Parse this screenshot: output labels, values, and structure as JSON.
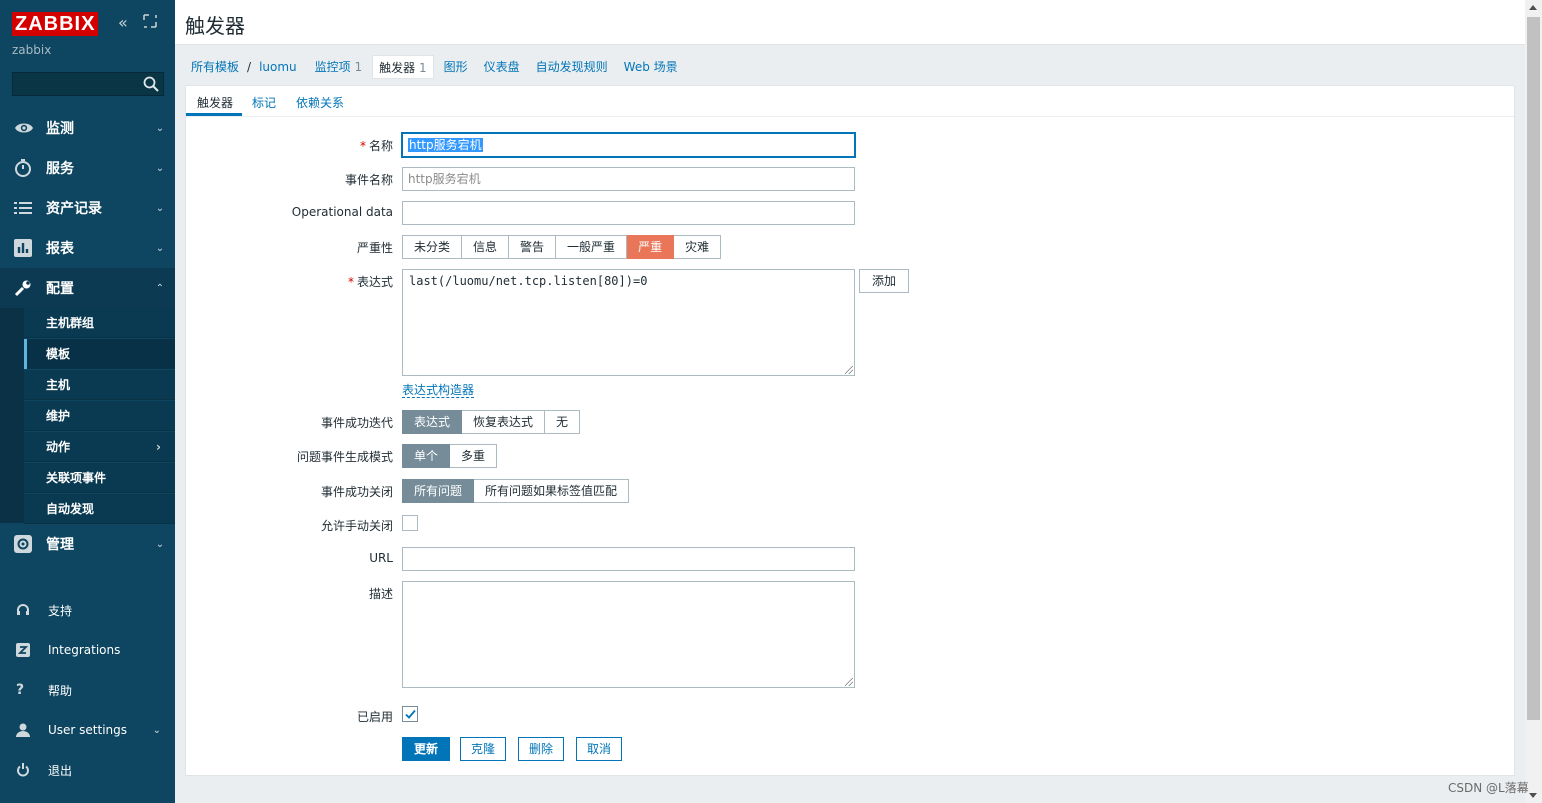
{
  "sidebar": {
    "logo": "ZABBIX",
    "server_name": "zabbix",
    "search_placeholder": "",
    "menu": [
      {
        "label": "监测",
        "icon": "eye-icon"
      },
      {
        "label": "服务",
        "icon": "stopwatch-icon"
      },
      {
        "label": "资产记录",
        "icon": "list-icon"
      },
      {
        "label": "报表",
        "icon": "bar-chart-icon"
      },
      {
        "label": "配置",
        "icon": "wrench-icon"
      }
    ],
    "config_submenu": [
      "主机群组",
      "模板",
      "主机",
      "维护",
      "动作",
      "关联项事件",
      "自动发现"
    ],
    "admin_label": "管理",
    "bottom": [
      {
        "label": "支持",
        "icon": "headset-icon"
      },
      {
        "label": "Integrations",
        "icon": "zabbix-z-icon"
      },
      {
        "label": "帮助",
        "icon": "question-icon"
      },
      {
        "label": "User settings",
        "icon": "user-icon"
      },
      {
        "label": "退出",
        "icon": "power-icon"
      }
    ]
  },
  "header": {
    "title": "触发器"
  },
  "breadcrumb": {
    "all_templates": "所有模板",
    "separator": "/",
    "template": "luomu",
    "items": "监控项",
    "items_count": "1",
    "triggers": "触发器",
    "triggers_count": "1",
    "graphs": "图形",
    "dashboards": "仪表盘",
    "discovery": "自动发现规则",
    "web": "Web 场景"
  },
  "tabs": [
    "触发器",
    "标记",
    "依赖关系"
  ],
  "form": {
    "name_label": "名称",
    "name_value": "http服务宕机",
    "event_name_label": "事件名称",
    "event_name_placeholder": "http服务宕机",
    "opdata_label": "Operational data",
    "opdata_value": "",
    "severity_label": "严重性",
    "severity_options": [
      "未分类",
      "信息",
      "警告",
      "一般严重",
      "严重",
      "灾难"
    ],
    "severity_selected": "严重",
    "expression_label": "表达式",
    "expression_value": "last(/luomu/net.tcp.listen[80])=0",
    "add_button": "添加",
    "expr_builder_link": "表达式构造器",
    "ok_event_gen_label": "事件成功迭代",
    "ok_event_gen_options": [
      "表达式",
      "恢复表达式",
      "无"
    ],
    "ok_event_gen_selected": "表达式",
    "problem_mode_label": "问题事件生成模式",
    "problem_mode_options": [
      "单个",
      "多重"
    ],
    "problem_mode_selected": "单个",
    "ok_close_label": "事件成功关闭",
    "ok_close_options": [
      "所有问题",
      "所有问题如果标签值匹配"
    ],
    "ok_close_selected": "所有问题",
    "manual_close_label": "允许手动关闭",
    "manual_close_checked": false,
    "url_label": "URL",
    "url_value": "",
    "desc_label": "描述",
    "desc_value": "",
    "enabled_label": "已启用",
    "enabled_checked": true,
    "btn_update": "更新",
    "btn_clone": "克隆",
    "btn_delete": "删除",
    "btn_cancel": "取消"
  },
  "watermark": "CSDN @L落幕",
  "colors": {
    "sidebar": "#0e4661",
    "accent": "#0275b8",
    "high_severity": "#e97659",
    "logo": "#d40000"
  }
}
